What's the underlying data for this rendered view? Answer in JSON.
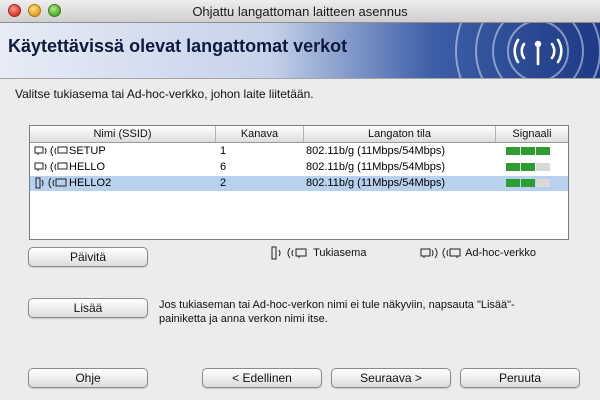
{
  "window": {
    "title": "Ohjattu langattoman laitteen asennus"
  },
  "banner": {
    "title": "Käytettävissä olevat langattomat verkot"
  },
  "instruction": "Valitse tukiasema tai Ad-hoc-verkko, johon laite liitetään.",
  "table": {
    "columns": [
      "Nimi (SSID)",
      "Kanava",
      "Langaton tila",
      "Signaali"
    ],
    "rows": [
      {
        "ssid": "SETUP",
        "channel": "1",
        "mode": "802.11b/g (11Mbps/54Mbps)",
        "type_icon": "adhoc-icon",
        "signal_bars": 3,
        "selected": false
      },
      {
        "ssid": "HELLO",
        "channel": "6",
        "mode": "802.11b/g (11Mbps/54Mbps)",
        "type_icon": "adhoc-icon",
        "signal_bars": 2,
        "selected": false
      },
      {
        "ssid": "HELLO2",
        "channel": "2",
        "mode": "802.11b/g (11Mbps/54Mbps)",
        "type_icon": "access-point-icon",
        "signal_bars": 2,
        "selected": true
      }
    ]
  },
  "legend": {
    "access_point": "Tukiasema",
    "adhoc": "Ad-hoc-verkko"
  },
  "buttons": {
    "refresh": "Päivitä",
    "add": "Lisää",
    "help": "Ohje",
    "back": "< Edellinen",
    "next": "Seuraava >",
    "cancel": "Peruuta"
  },
  "note": "Jos tukiaseman tai Ad-hoc-verkon nimi ei tule näkyviin, napsauta \"Lisää\"-painiketta ja anna verkon nimi itse.",
  "colors": {
    "selection": "#b7d1ee",
    "signal_on": "#2e9e32",
    "signal_off": "#d9d9d9"
  }
}
